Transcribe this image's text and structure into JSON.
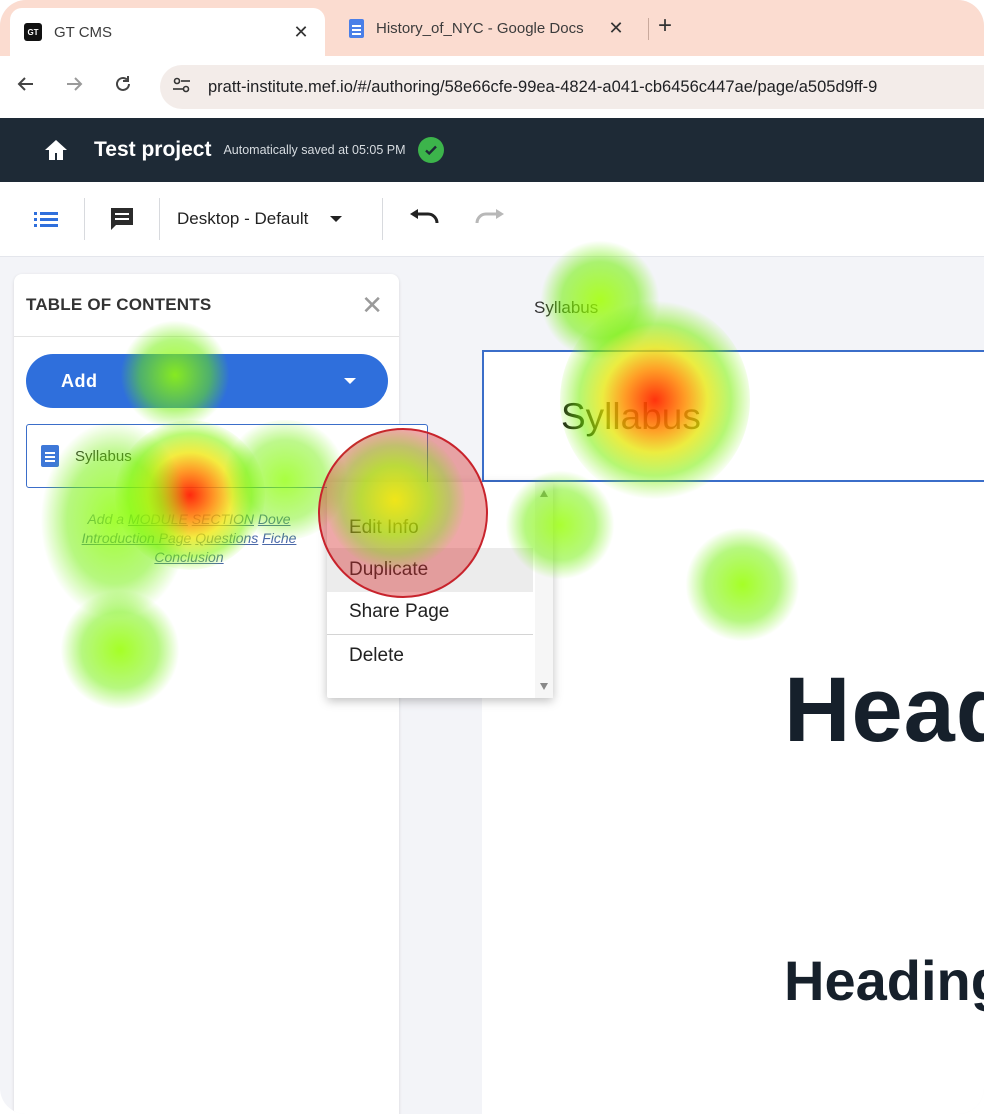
{
  "browser": {
    "tabs": [
      {
        "favicon": "gt-cms-favicon",
        "favicon_text": "GT",
        "title": "GT CMS",
        "active": true
      },
      {
        "favicon": "google-docs-icon",
        "title": "History_of_NYC - Google Docs",
        "active": false
      }
    ],
    "new_tab": "+",
    "url": "pratt-institute.mef.io/#/authoring/58e66cfe-99ea-4824-a041-cb6456c447ae/page/a505d9ff-9"
  },
  "app": {
    "project_name": "Test project",
    "save_status": "Automatically saved at 05:05 PM",
    "save_status_color": "#3cb44b"
  },
  "toolbar": {
    "device_select": "Desktop - Default"
  },
  "toc": {
    "title": "TABLE OF CONTENTS",
    "add_button": "Add",
    "items": [
      {
        "label": "Syllabus",
        "icon": "document-icon"
      }
    ],
    "hint": {
      "prefix": "Add a",
      "link1": "MODULE",
      "link2": "SECTION",
      "link3": "Dove",
      "link4": "Introduction Page",
      "link5": "Questions",
      "link6": "Fiche",
      "link7": "Conclusion"
    }
  },
  "canvas": {
    "breadcrumb": "Syllabus",
    "title_block": "Syllabus",
    "heading1": "Heading",
    "heading2": "Heading"
  },
  "context_menu": {
    "items": [
      "Edit Info",
      "Duplicate",
      "Share Page",
      "Delete"
    ],
    "highlighted": "Duplicate"
  },
  "colors": {
    "header_bg": "#1e2a36",
    "accent": "#2f6fdc",
    "tab_strip": "#fbdcd0"
  }
}
